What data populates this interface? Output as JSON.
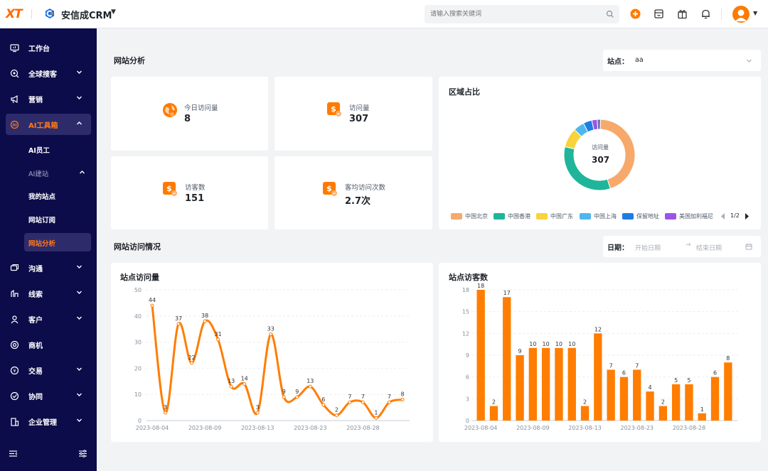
{
  "topbar": {
    "logo": "XT",
    "brand_name": "安信成CRM",
    "search_placeholder": "请输入搜索关键词"
  },
  "sidebar": {
    "items": [
      {
        "label": "工作台",
        "icon": "monitor-icon"
      },
      {
        "label": "全球搜客",
        "icon": "search-globe-icon"
      },
      {
        "label": "营销",
        "icon": "megaphone-icon"
      },
      {
        "label": "AI工具箱",
        "icon": "ai-toolbox-icon"
      },
      {
        "label": "沟通",
        "icon": "chat-icon"
      },
      {
        "label": "线索",
        "icon": "lead-icon"
      },
      {
        "label": "客户",
        "icon": "customer-icon"
      },
      {
        "label": "商机",
        "icon": "opportunity-icon"
      },
      {
        "label": "交易",
        "icon": "trade-icon"
      },
      {
        "label": "协同",
        "icon": "collaborate-icon"
      },
      {
        "label": "企业管理",
        "icon": "enterprise-icon"
      }
    ],
    "subitems": [
      "AI员工",
      "AI建站",
      "我的站点",
      "网站订阅",
      "网站分析"
    ]
  },
  "analysis": {
    "title": "网站分析",
    "site_label": "站点：",
    "site_value": "aa",
    "kpis": [
      {
        "label": "今日访问量",
        "value": "8",
        "icon": "globe-icon"
      },
      {
        "label": "访问量",
        "value": "307",
        "icon": "dollar-doc-icon"
      },
      {
        "label": "访客数",
        "value": "151",
        "icon": "dollar-doc-icon"
      },
      {
        "label": "客均访问次数",
        "value": "2.7次",
        "icon": "dollar-doc-icon"
      }
    ]
  },
  "region": {
    "title": "区域占比",
    "center_label": "访问量",
    "center_value": "307",
    "legend": [
      "中国北京",
      "中国香港",
      "中国广东",
      "中国上海",
      "保留地址",
      "美国加利福尼"
    ],
    "page": "1/2",
    "colors": [
      "#f7a96b",
      "#1fb59a",
      "#f8d33c",
      "#4fb7ef",
      "#1c7ee3",
      "#9b54e8",
      "#6a6fa8"
    ],
    "slices": [
      0.45,
      0.34,
      0.09,
      0.05,
      0.04,
      0.025,
      0.015
    ]
  },
  "visits": {
    "title": "网站访问情况",
    "date_label": "日期：",
    "start_placeholder": "开始日期",
    "end_placeholder": "结束日期"
  },
  "chart_data": [
    {
      "type": "line",
      "title": "站点访问量",
      "ylim": [
        0,
        50
      ],
      "yticks": [
        0,
        10,
        20,
        30,
        40,
        50
      ],
      "xticks": [
        "2023-08-04",
        "2023-08-09",
        "2023-08-13",
        "2023-08-23",
        "2023-08-28"
      ],
      "values": [
        44,
        3,
        37,
        22,
        38,
        31,
        13,
        14,
        3,
        33,
        9,
        9,
        13,
        6,
        2,
        7,
        7,
        1,
        7,
        8
      ],
      "color": "#ff7d00"
    },
    {
      "type": "bar",
      "title": "站点访客数",
      "ylim": [
        0,
        18
      ],
      "yticks": [
        0,
        3,
        6,
        9,
        12,
        15,
        18
      ],
      "xticks": [
        "2023-08-04",
        "2023-08-09",
        "2023-08-13",
        "2023-08-23",
        "2023-08-28"
      ],
      "values": [
        18,
        2,
        17,
        9,
        10,
        10,
        10,
        10,
        2,
        12,
        7,
        6,
        7,
        4,
        2,
        5,
        5,
        1,
        6,
        8
      ],
      "color": "#ff7d00"
    }
  ]
}
